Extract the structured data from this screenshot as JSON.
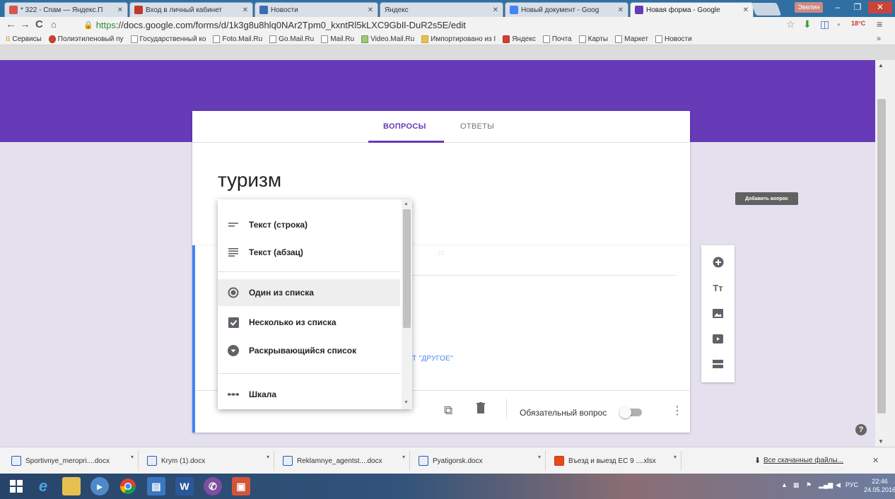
{
  "browser": {
    "tabs": [
      {
        "label": "* 322 - Спам — Яндекс.П",
        "color": "#d9534f"
      },
      {
        "label": "Вход в личный кабинет",
        "color": "#c0392b"
      },
      {
        "label": "Новости",
        "color": "#3b6bb5"
      },
      {
        "label": "Яндекс",
        "color": ""
      },
      {
        "label": "Новый документ - Goog",
        "color": "#4285f4"
      },
      {
        "label": "Новая форма - Google",
        "color": "#673ab7"
      }
    ],
    "user_badge": "Эвелин",
    "url_https": "https",
    "url_rest": "://docs.google.com/forms/d/1k3g8u8hlq0NAr2Tpm0_kxntRl5kLXC9GbIl-DuR2s5E/edit",
    "bookmarks": [
      "Сервисы",
      "Полиэтиленовый пу",
      "Государственный ко",
      "Foto.Mail.Ru",
      "Go.Mail.Ru",
      "Mail.Ru",
      "Video.Mail.Ru",
      "Импортировано из I",
      "Яндекс",
      "Почта",
      "Карты",
      "Маркет",
      "Новости"
    ],
    "bookmarks_more": "»",
    "weather_badge": "18°C"
  },
  "form": {
    "tab_questions": "ВОПРОСЫ",
    "tab_answers": "ОТВЕТЫ",
    "title": "туризм",
    "drag_handle": ":::",
    "other_option_link": "Т \"ДРУГОЕ\"",
    "required_label": "Обязательный вопрос",
    "add_question_tooltip": "Добавить вопрос"
  },
  "question_type_menu": {
    "items": [
      {
        "label": "Текст (строка)",
        "icon": "short-text-icon"
      },
      {
        "label": "Текст (абзац)",
        "icon": "paragraph-icon"
      },
      {
        "label": "Один из списка",
        "icon": "radio-icon"
      },
      {
        "label": "Несколько из списка",
        "icon": "checkbox-icon"
      },
      {
        "label": "Раскрывающийся список",
        "icon": "dropdown-icon"
      },
      {
        "label": "Шкала",
        "icon": "scale-icon"
      }
    ],
    "selected": "Один из списка"
  },
  "downloads": {
    "items": [
      "Sportivnye_meropri....docx",
      "Krym (1).docx",
      "Reklamnye_agentst....docx",
      "Pyatigorsk.docx",
      "Въезд и выезд ЕС 9 ....xlsx"
    ],
    "show_all": "Все скачанные файлы..."
  },
  "taskbar": {
    "language": "РУС",
    "time": "22:46",
    "date": "24.05.2016"
  },
  "colors": {
    "accent": "#673ab7",
    "page_bg": "#e4e0ee",
    "question_border": "#4285f4"
  }
}
